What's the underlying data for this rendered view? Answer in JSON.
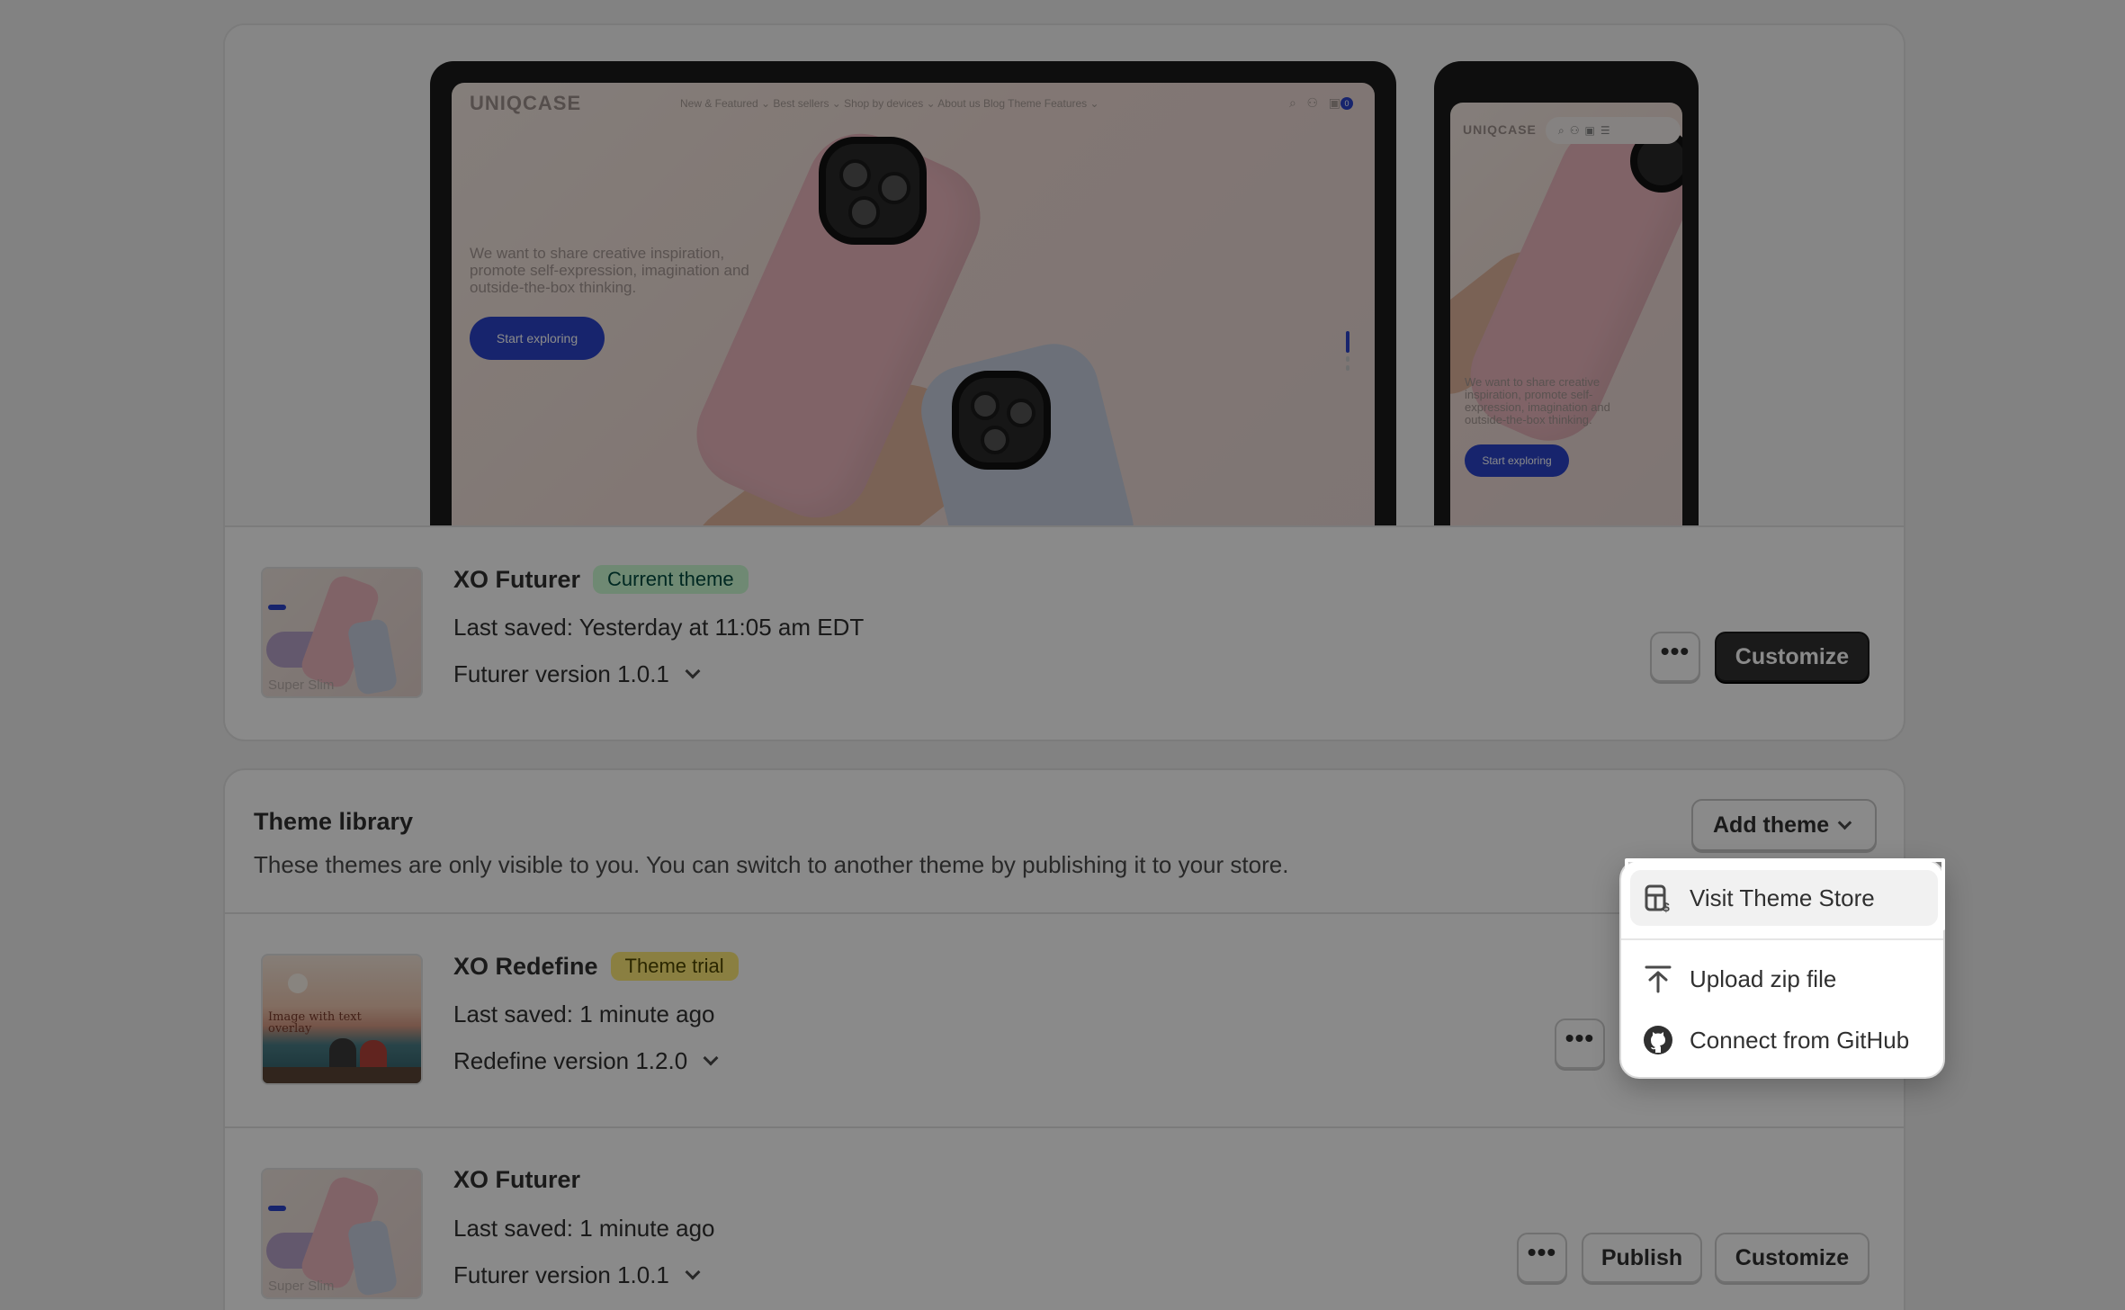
{
  "current_theme": {
    "preview": {
      "brand": "UNIQCASE",
      "nav_items": "New & Featured ⌄   Best sellers ⌄   Shop by devices ⌄   About us   Blog   Theme Features ⌄",
      "tagline": "We want to share creative inspiration, promote self-expression, imagination and outside-the-box thinking.",
      "cta": "Start exploring",
      "cart_count": "0"
    },
    "name": "XO Futurer",
    "badge": "Current theme",
    "last_saved": "Last saved: Yesterday at 11:05 am EDT",
    "version": "Futurer version 1.0.1",
    "thumb_caption": "Super Slim",
    "more_button": "•••",
    "customize_button": "Customize"
  },
  "library": {
    "title": "Theme library",
    "description": "These themes are only visible to you. You can switch to another theme by publishing it to your store.",
    "add_theme_button": "Add theme",
    "themes": [
      {
        "name": "XO Redefine",
        "badge": "Theme trial",
        "last_saved": "Last saved: 1 minute ago",
        "version": "Redefine version 1.2.0",
        "thumb_caption": "Image with text\noverlay",
        "more_button": "•••"
      },
      {
        "name": "XO Futurer",
        "last_saved": "Last saved: 1 minute ago",
        "version": "Futurer version 1.0.1",
        "thumb_caption": "Super Slim",
        "more_button": "•••",
        "publish_button": "Publish",
        "customize_button": "Customize"
      }
    ]
  },
  "add_theme_menu": {
    "items": [
      {
        "label": "Visit Theme Store",
        "icon": "theme-store-icon"
      },
      {
        "label": "Upload zip file",
        "icon": "upload-icon"
      },
      {
        "label": "Connect from GitHub",
        "icon": "github-icon"
      }
    ]
  },
  "colors": {
    "badge_current_bg": "#cdfed4",
    "badge_trial_bg": "#ffeb78",
    "primary_button": "#303030",
    "preview_cta": "#2c43c9"
  }
}
